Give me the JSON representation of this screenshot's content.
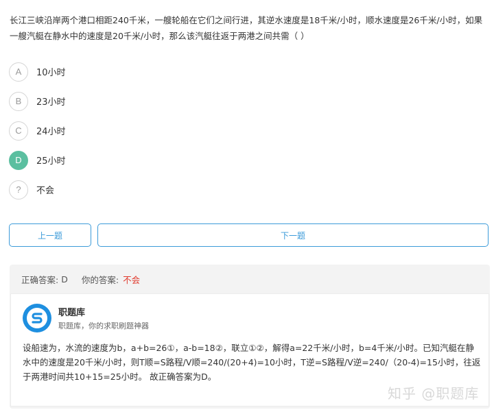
{
  "question": {
    "text": "长江三峡沿岸两个港口相距240千米，一艘轮船在它们之间行进，其逆水速度是18千米/小时，顺水速度是26千米/小时，如果一艘汽艇在静水中的速度是20千米/小时，那么该汽艇往返于两港之间共需（ ）"
  },
  "options": [
    {
      "key": "A",
      "text": "10小时",
      "selected": false
    },
    {
      "key": "B",
      "text": "23小时",
      "selected": false
    },
    {
      "key": "C",
      "text": "24小时",
      "selected": false
    },
    {
      "key": "D",
      "text": "25小时",
      "selected": true
    },
    {
      "key": "?",
      "text": "不会",
      "selected": false
    }
  ],
  "nav": {
    "prev_label": "上一题",
    "next_label": "下一题"
  },
  "answer": {
    "correct_label": "正确答案:",
    "correct_value": "D",
    "yours_label": "你的答案:",
    "yours_value": "不会"
  },
  "source": {
    "name": "职题库",
    "subtitle": "职题库，你的求职刷题神器",
    "logo_icon": "s-logo-icon"
  },
  "explanation": "设船速为，水流的速度为b，a+b=26①，a-b=18②，联立①②，解得a=22千米/小时，b=4千米/小时。已知汽艇在静水中的速度是20千米/小时，则T顺=S路程/V顺=240/(20+4)=10小时，T逆=S路程/V逆=240/（20-4)=15小时，往返于两港时间共10+15=25小时。 故正确答案为D。",
  "watermark": "知乎 @职题库",
  "colors": {
    "accent": "#3a9ad9",
    "selected": "#5bbfa0",
    "wrong": "#e03b2e",
    "logo": "#1e8fe0"
  }
}
